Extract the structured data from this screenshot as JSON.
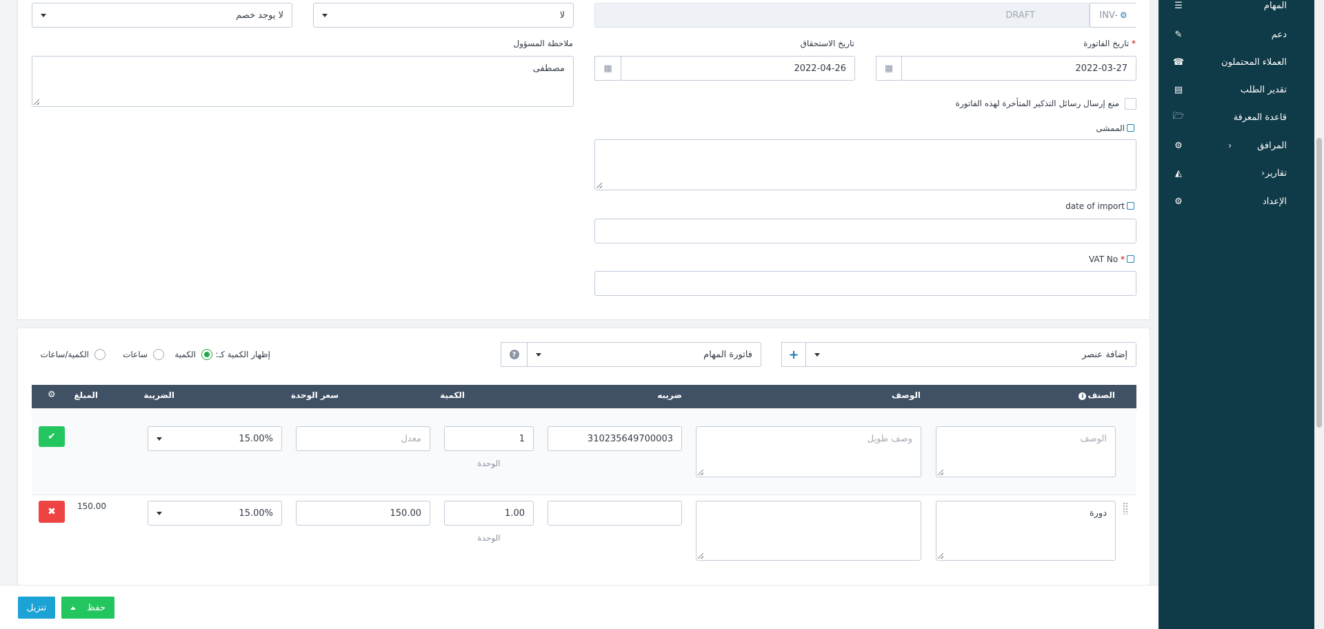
{
  "top_row": {
    "discount_select": "لا يوجد خصم",
    "no_select": "لا",
    "draft_value": "DRAFT",
    "prefix": "INV-"
  },
  "dates": {
    "invoice_date_label": "تاريخ الفاتورة",
    "invoice_date_value": "2022-03-27",
    "due_date_label": "تاريخ الاستحقاق",
    "due_date_value": "2022-04-26"
  },
  "admin_note": {
    "label": "ملاحظة المسؤول",
    "value": "مصطفى"
  },
  "reminder_checkbox_label": "منع إرسال رسائل التذكير المتأخرة لهذه الفاتورة",
  "custom_fields": {
    "representative_label": "الممشى",
    "date_import_label": "date of import",
    "vat_label": "VAT No"
  },
  "items_toolbar": {
    "add_item": "إضافة عنصر",
    "tasks_invoice": "فاتورة المهام",
    "show_qty_as": "إظهار الكمية كـ:",
    "opt_qty": "الكمية",
    "opt_hours": "ساعات",
    "opt_qty_hours": "الكمية/ساعات"
  },
  "table_headers": {
    "item": "الصنف",
    "description": "الوصف",
    "tax_code": "ضريبه",
    "qty": "الكمية",
    "unit_price": "سعر الوحدة",
    "tax": "الضريبة",
    "amount": "المبلغ"
  },
  "new_row": {
    "item_placeholder": "الوصف",
    "long_desc_placeholder": "وصف طويل",
    "tax_code": "310235649700003",
    "qty": "1",
    "unit_label": "الوحدة",
    "rate_placeholder": "معدل",
    "tax": "15.00%"
  },
  "row1": {
    "item": "دورة",
    "qty": "1.00",
    "unit_label": "الوحدة",
    "rate": "150.00",
    "tax": "15.00%",
    "amount": "150.00"
  },
  "footer": {
    "save": "حفظ",
    "download": "تنزيل"
  },
  "sidebar": {
    "items": [
      {
        "label": "المهام",
        "icon": "tasks-icon"
      },
      {
        "label": "دعم",
        "icon": "ticket-icon"
      },
      {
        "label": "العملاء المحتملون",
        "icon": "phone-icon"
      },
      {
        "label": "تقدير الطلب",
        "icon": "list-icon"
      },
      {
        "label": "قاعدة المعرفة",
        "icon": "folder-open-icon"
      },
      {
        "label": "المرافق",
        "icon": "cogs-icon"
      },
      {
        "label": "تقارير",
        "icon": "area-chart-icon"
      },
      {
        "label": "الإعداد",
        "icon": "gear-icon"
      }
    ]
  }
}
